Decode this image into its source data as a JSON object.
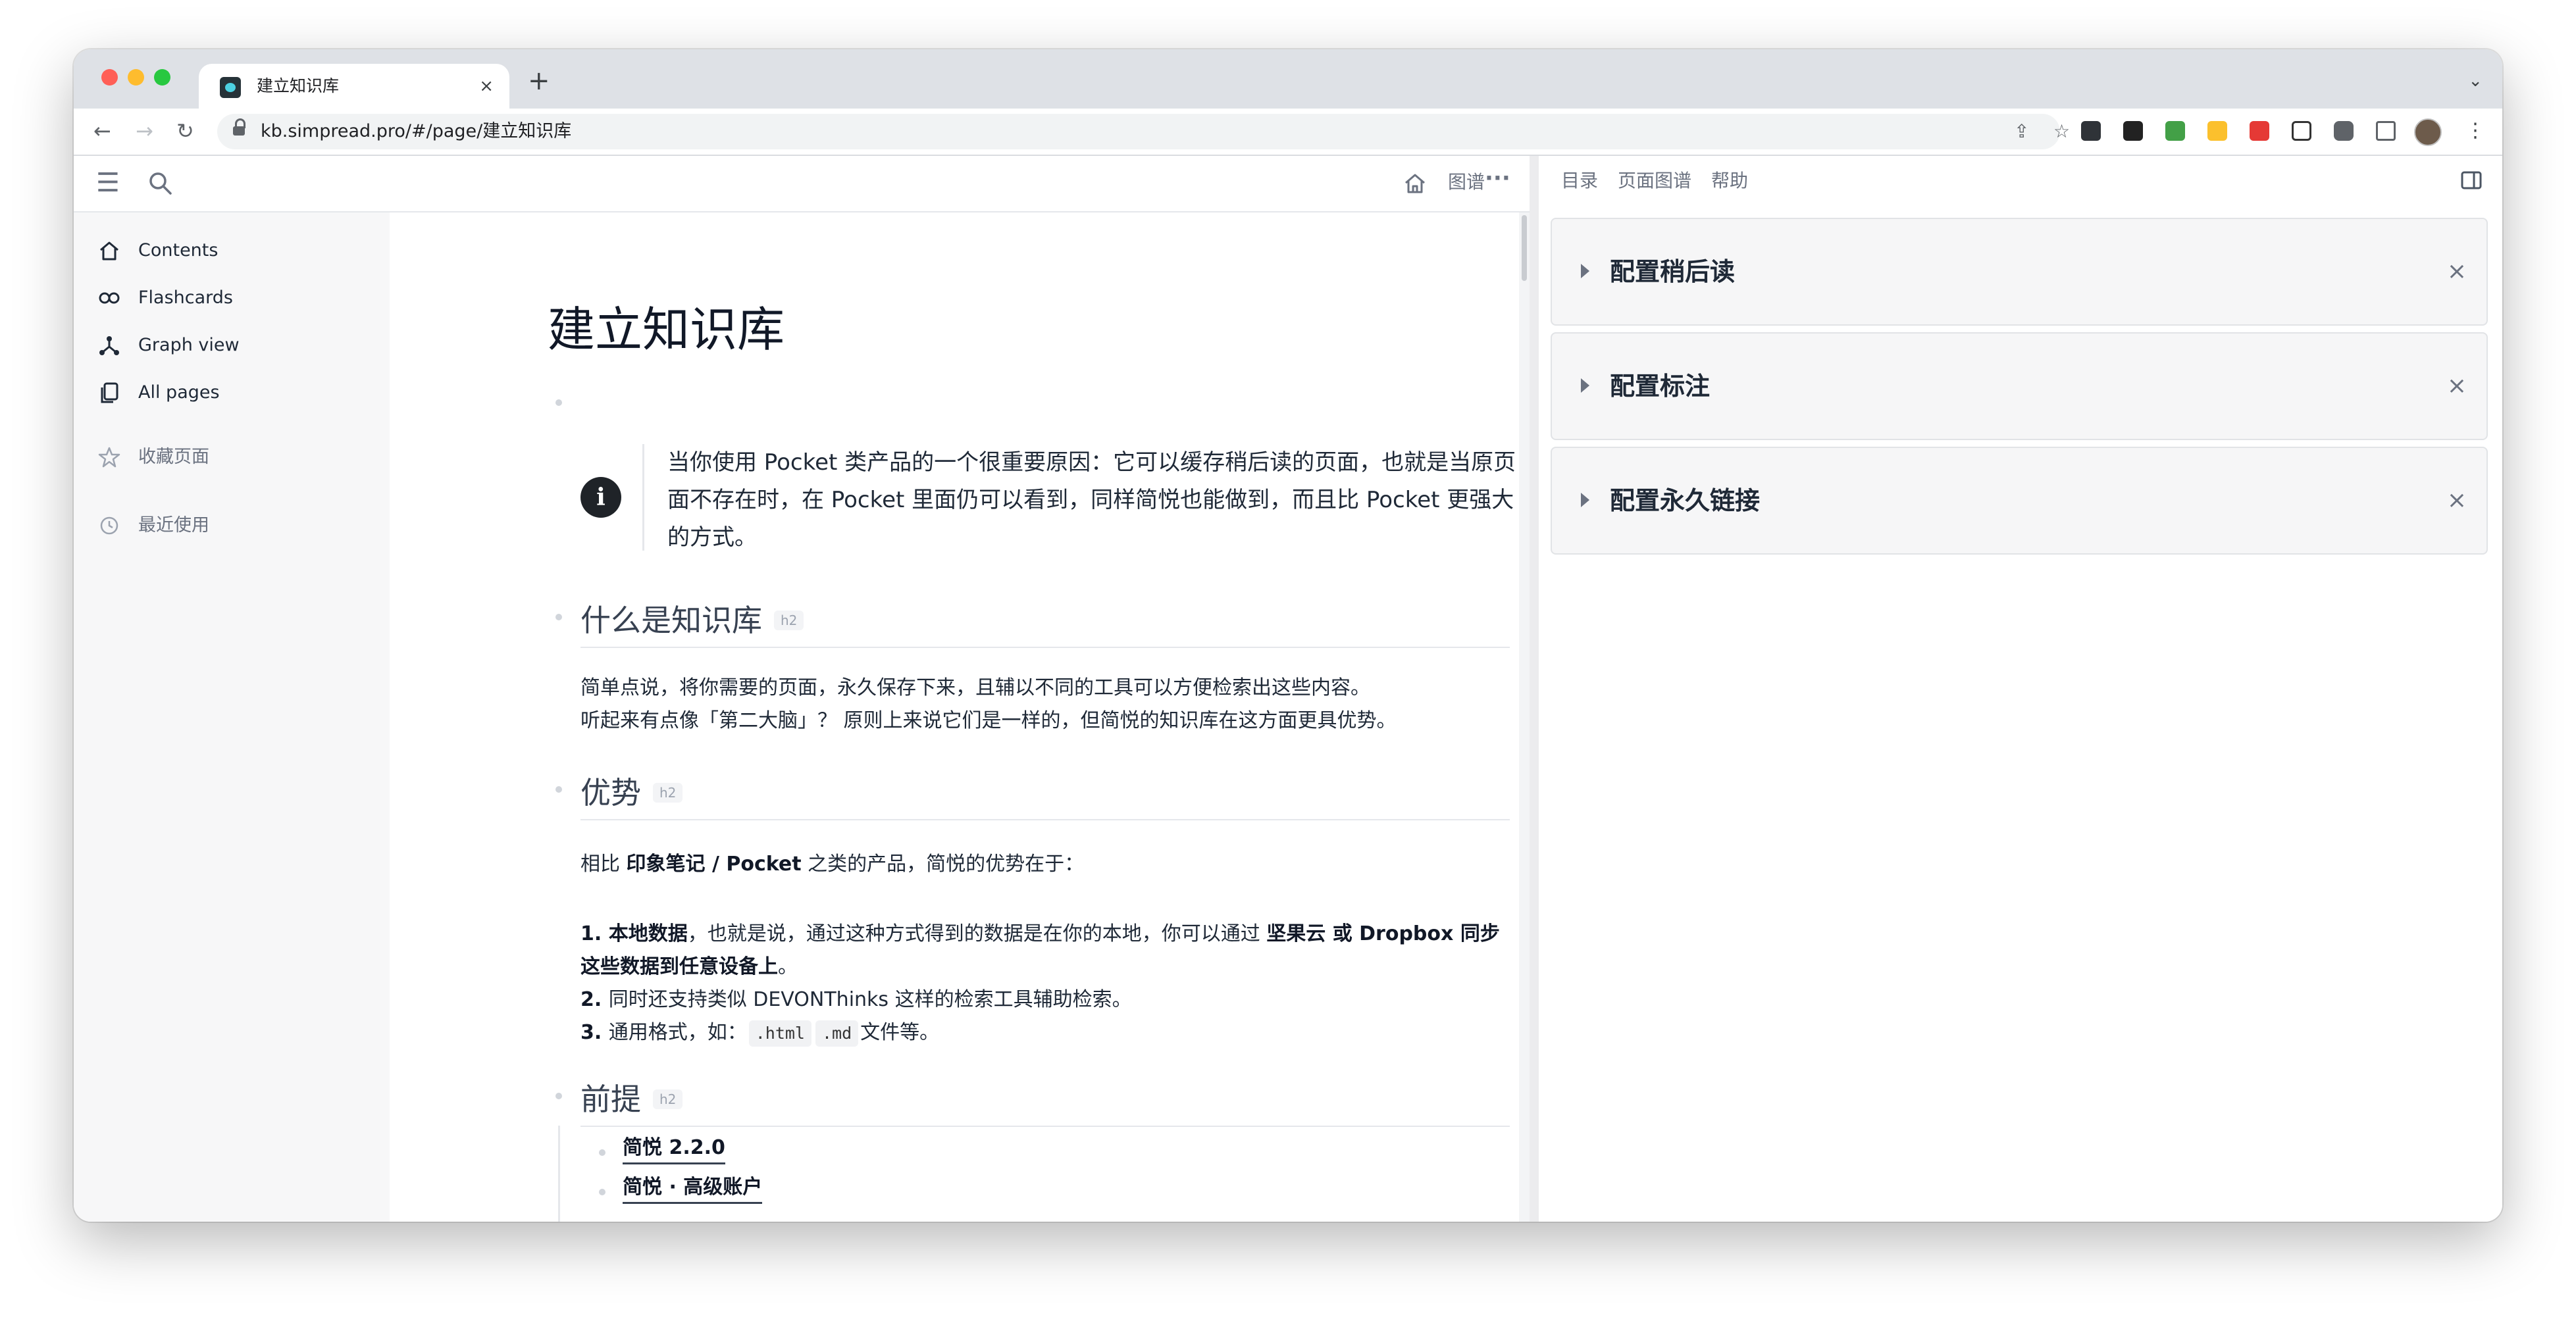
{
  "browser": {
    "tab_title": "建立知识库",
    "tab_close": "×",
    "new_tab": "+",
    "tab_menu": "⌄",
    "url": "kb.simpread.pro/#/page/建立知识库",
    "back": "←",
    "forward": "→",
    "reload": "↻",
    "share": "⇪",
    "bookmark": "☆",
    "more": "⋮"
  },
  "topbar": {
    "menu_icon": "☰",
    "search_icon": "⌕",
    "home_icon": "⌂",
    "graph_label": "图谱",
    "more_icon": "···"
  },
  "right_topbar": {
    "toc_label": "目录",
    "page_graph_label": "页面图谱",
    "help_label": "帮助"
  },
  "sidebar": {
    "items": [
      {
        "label": "Contents"
      },
      {
        "label": "Flashcards"
      },
      {
        "label": "Graph view"
      },
      {
        "label": "All pages"
      }
    ],
    "favorites_label": "收藏页面",
    "recent_label": "最近使用"
  },
  "page": {
    "title": "建立知识库",
    "callout": {
      "icon": "i",
      "text": "当你使用 Pocket 类产品的一个很重要原因：它可以缓存稍后读的页面，也就是当原页面不存在时，在 Pocket 里面仍可以看到，同样简悦也能做到，而且比 Pocket 更强大的方式。"
    },
    "section1": {
      "heading": "什么是知识库",
      "tag": "h2",
      "line1": "简单点说，将你需要的页面，永久保存下来，且辅以不同的工具可以方便检索出这些内容。",
      "line2": "听起来有点像「第二大脑」？ 原则上来说它们是一样的，但简悦的知识库在这方面更具优势。"
    },
    "section2": {
      "heading": "优势",
      "tag": "h2",
      "intro_pre": "相比 ",
      "intro_bold": "印象笔记 / Pocket",
      "intro_post": " 之类的产品，简悦的优势在于：",
      "item1_num": "1. ",
      "item1_bold": "本地数据",
      "item1_mid": "，也就是说，通过这种方式得到的数据是在你的本地，你可以通过 ",
      "item1_bold2": "坚果云 或 Dropbox 同步这些数据到任意设备上",
      "item1_end": "。",
      "item2_num": "2. ",
      "item2_text": "同时还支持类似 DEVONThinks 这样的检索工具辅助检索。",
      "item3_num": "3. ",
      "item3_text": "通用格式，如：",
      "code1": ".html",
      "code2": ".md",
      "item3_end": "文件等。"
    },
    "section3": {
      "heading": "前提",
      "tag": "h2",
      "links": [
        "简悦 2.2.0",
        "简悦 · 高级账户"
      ]
    }
  },
  "right_panel": {
    "panels": [
      {
        "title": "配置稍后读",
        "close": "×"
      },
      {
        "title": "配置标注",
        "close": "×"
      },
      {
        "title": "配置永久链接",
        "close": "×"
      }
    ]
  },
  "colors": {
    "close_red": "#ff5f57",
    "minimize_yellow": "#febc2e",
    "zoom_green": "#28c840"
  }
}
